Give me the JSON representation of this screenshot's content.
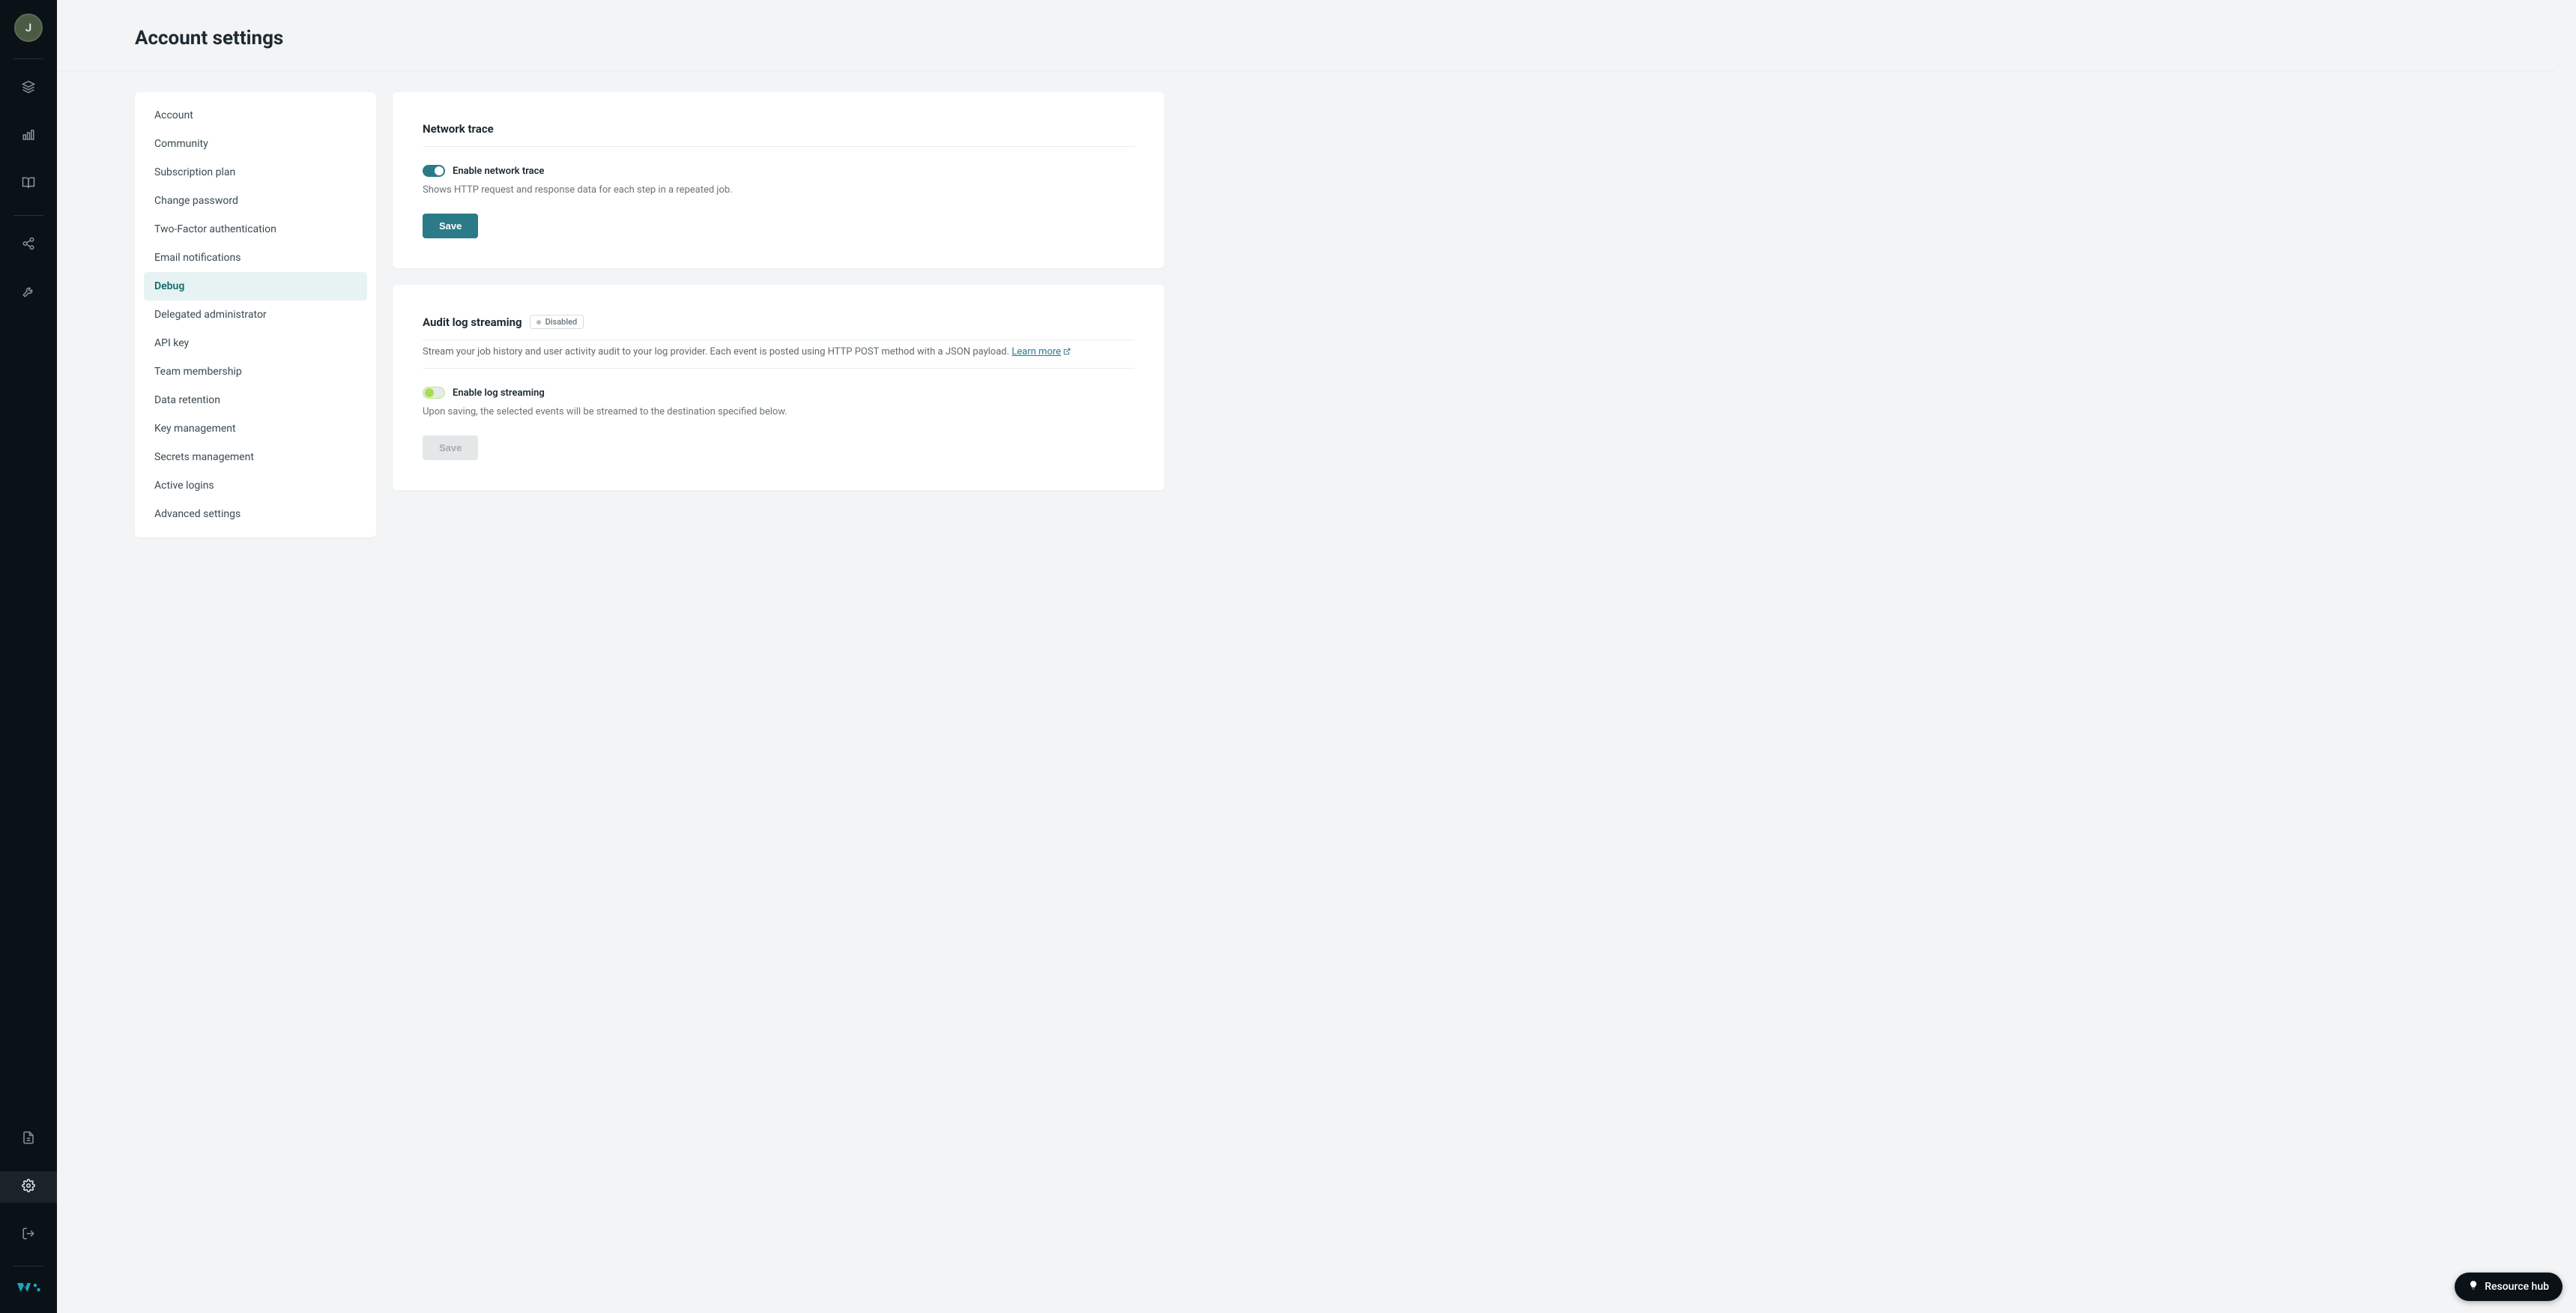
{
  "avatar_initial": "J",
  "page_title": "Account settings",
  "settings_nav": [
    {
      "label": "Account",
      "active": false
    },
    {
      "label": "Community",
      "active": false
    },
    {
      "label": "Subscription plan",
      "active": false
    },
    {
      "label": "Change password",
      "active": false
    },
    {
      "label": "Two-Factor authentication",
      "active": false
    },
    {
      "label": "Email notifications",
      "active": false
    },
    {
      "label": "Debug",
      "active": true
    },
    {
      "label": "Delegated administrator",
      "active": false
    },
    {
      "label": "API key",
      "active": false
    },
    {
      "label": "Team membership",
      "active": false
    },
    {
      "label": "Data retention",
      "active": false
    },
    {
      "label": "Key management",
      "active": false
    },
    {
      "label": "Secrets management",
      "active": false
    },
    {
      "label": "Active logins",
      "active": false
    },
    {
      "label": "Advanced settings",
      "active": false
    }
  ],
  "network_trace": {
    "heading": "Network trace",
    "toggle_label": "Enable network trace",
    "toggle_on": true,
    "description": "Shows HTTP request and response data for each step in a repeated job.",
    "save_label": "Save"
  },
  "audit_log": {
    "heading": "Audit log streaming",
    "badge": "Disabled",
    "subtext": "Stream your job history and user activity audit to your log provider. Each event is posted using HTTP POST method with a JSON payload.",
    "learn_more": "Learn more",
    "toggle_label": "Enable log streaming",
    "toggle_on": false,
    "description": "Upon saving, the selected events will be streamed to the destination specified below.",
    "save_label": "Save",
    "save_disabled": true
  },
  "resource_hub_label": "Resource hub"
}
